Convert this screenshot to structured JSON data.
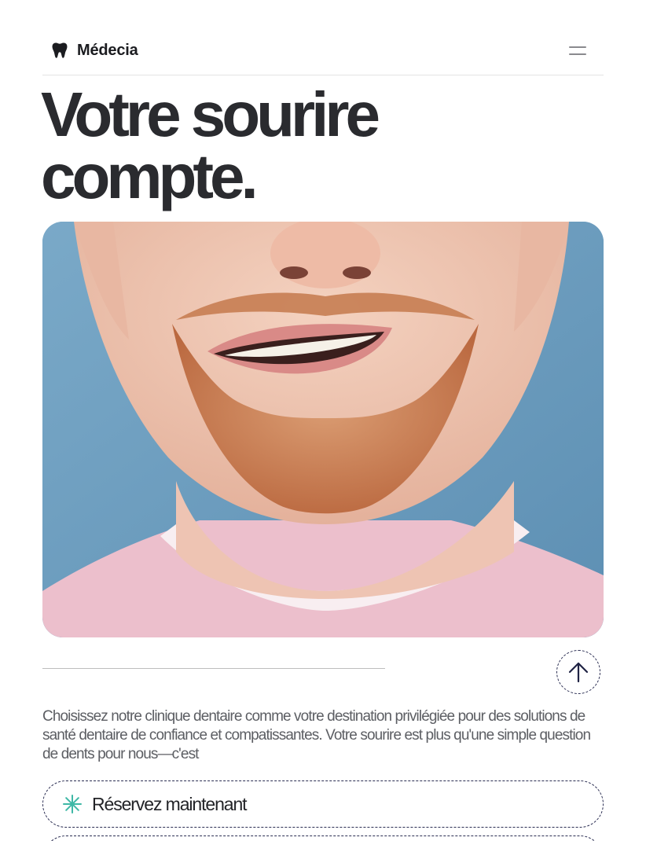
{
  "header": {
    "brand_name": "Médecia",
    "brand_icon": "tooth-icon",
    "menu_icon": "hamburger-menu-icon"
  },
  "hero": {
    "title_line1": "Votre sourire",
    "title_line2": "compte.",
    "image_icon": "smiling-man-photo"
  },
  "actions": {
    "scroll_top_icon": "arrow-up-icon"
  },
  "description": "Choisissez notre clinique dentaire comme votre destination privilégiée pour des solutions de santé dentaire de confiance et compatissantes. Votre sourire est plus qu'une simple question de dents pour nous—c'est",
  "cta": {
    "label": "Réservez maintenant",
    "icon": "asterisk-icon"
  },
  "colors": {
    "accent": "#3fb8a6",
    "text_dark": "#232428",
    "border_dark": "#2a2d52",
    "photo_background": "#6f9fc0"
  }
}
